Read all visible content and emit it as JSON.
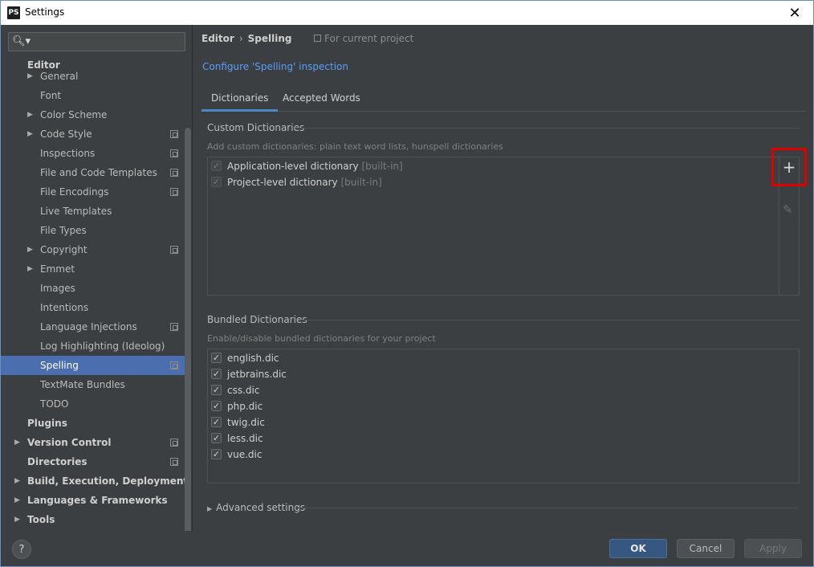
{
  "window": {
    "title": "Settings",
    "app_icon_text": "PS",
    "close_glyph": "✕"
  },
  "search": {
    "icon": "search-icon",
    "placeholder": ""
  },
  "tree": {
    "items": [
      {
        "label": "Editor",
        "level": 0,
        "bold": true,
        "arrow": ""
      },
      {
        "label": "General",
        "level": 1,
        "arrow": "▶"
      },
      {
        "label": "Font",
        "level": 1,
        "arrow": ""
      },
      {
        "label": "Color Scheme",
        "level": 1,
        "arrow": "▶"
      },
      {
        "label": "Code Style",
        "level": 1,
        "arrow": "▶",
        "project": true
      },
      {
        "label": "Inspections",
        "level": 1,
        "arrow": "",
        "project": true
      },
      {
        "label": "File and Code Templates",
        "level": 1,
        "arrow": "",
        "project": true
      },
      {
        "label": "File Encodings",
        "level": 1,
        "arrow": "",
        "project": true
      },
      {
        "label": "Live Templates",
        "level": 1,
        "arrow": ""
      },
      {
        "label": "File Types",
        "level": 1,
        "arrow": ""
      },
      {
        "label": "Copyright",
        "level": 1,
        "arrow": "▶",
        "project": true
      },
      {
        "label": "Emmet",
        "level": 1,
        "arrow": "▶"
      },
      {
        "label": "Images",
        "level": 1,
        "arrow": ""
      },
      {
        "label": "Intentions",
        "level": 1,
        "arrow": ""
      },
      {
        "label": "Language Injections",
        "level": 1,
        "arrow": "",
        "project": true
      },
      {
        "label": "Log Highlighting (Ideolog)",
        "level": 1,
        "arrow": ""
      },
      {
        "label": "Spelling",
        "level": 1,
        "arrow": "",
        "project": true,
        "selected": true
      },
      {
        "label": "TextMate Bundles",
        "level": 1,
        "arrow": ""
      },
      {
        "label": "TODO",
        "level": 1,
        "arrow": ""
      },
      {
        "label": "Plugins",
        "level": 0,
        "bold": true,
        "arrow": ""
      },
      {
        "label": "Version Control",
        "level": 0,
        "bold": true,
        "arrow": "▶",
        "project": true
      },
      {
        "label": "Directories",
        "level": 0,
        "bold": true,
        "arrow": "",
        "project": true
      },
      {
        "label": "Build, Execution, Deployment",
        "level": 0,
        "bold": true,
        "arrow": "▶"
      },
      {
        "label": "Languages & Frameworks",
        "level": 0,
        "bold": true,
        "arrow": "▶"
      },
      {
        "label": "Tools",
        "level": 0,
        "bold": true,
        "arrow": "▶"
      }
    ]
  },
  "breadcrumb": {
    "parent": "Editor",
    "separator": "›",
    "current": "Spelling",
    "scope": "For current project"
  },
  "configure_link": "Configure 'Spelling' inspection",
  "tabs": [
    {
      "label": "Dictionaries",
      "active": true
    },
    {
      "label": "Accepted Words",
      "active": false
    }
  ],
  "custom": {
    "title": "Custom Dictionaries",
    "hint": "Add custom dictionaries: plain text word lists, hunspell dictionaries",
    "items": [
      {
        "name": "Application-level dictionary",
        "tag": "[built-in]",
        "checked": true
      },
      {
        "name": "Project-level dictionary",
        "tag": "[built-in]",
        "checked": true
      }
    ],
    "add_glyph": "+",
    "edit_glyph": "✎"
  },
  "bundled": {
    "title": "Bundled Dictionaries",
    "hint": "Enable/disable bundled dictionaries for your project",
    "items": [
      {
        "name": "english.dic",
        "checked": true
      },
      {
        "name": "jetbrains.dic",
        "checked": true
      },
      {
        "name": "css.dic",
        "checked": true
      },
      {
        "name": "php.dic",
        "checked": true
      },
      {
        "name": "twig.dic",
        "checked": true
      },
      {
        "name": "less.dic",
        "checked": true
      },
      {
        "name": "vue.dic",
        "checked": true
      }
    ]
  },
  "advanced": {
    "label": "Advanced settings",
    "arrow": "▶"
  },
  "footer": {
    "help": "?",
    "ok": "OK",
    "cancel": "Cancel",
    "apply": "Apply"
  },
  "check_glyph": "✓"
}
